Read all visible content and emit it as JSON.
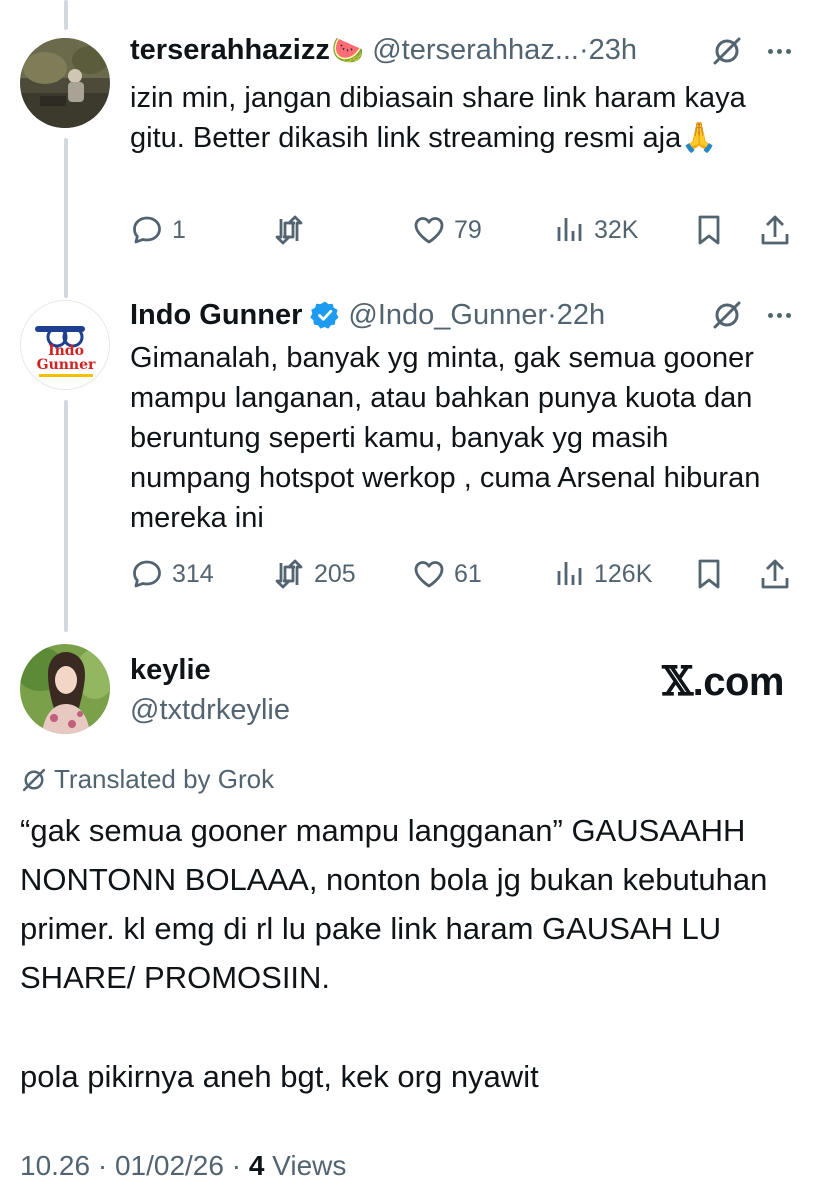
{
  "tweets": [
    {
      "name": "terserahhazizz",
      "emoji": "🍉",
      "handle": "@terserahhaz...",
      "time": "·23h",
      "text": "izin min, jangan dibiasain share link haram kaya gitu. Better dikasih link streaming resmi aja🙏",
      "replies": "1",
      "retweets": "",
      "likes": "79",
      "views": "32K"
    },
    {
      "name": "Indo Gunner",
      "handle": "@Indo_Gunner",
      "time": "·22h",
      "text": "Gimanalah, banyak yg minta, gak semua gooner mampu langanan, atau bahkan punya kuota dan beruntung seperti kamu, banyak yg masih numpang hotspot werkop , cuma Arsenal hiburan mereka ini",
      "replies": "314",
      "retweets": "205",
      "likes": "61",
      "views": "126K",
      "avatar_text": "Indo Gunner"
    }
  ],
  "main": {
    "name": "keylie",
    "handle": "@txtdrkeylie",
    "watermark_x": "𝕏",
    "watermark_rest": ".com",
    "translated_label": "Translated by Grok",
    "paragraph1": "“gak semua gooner mampu langganan” GAUSAAHH NONTONN BOLAAA, nonton bola jg bukan kebutuhan primer. kl emg di rl lu pake link haram GAUSAH LU SHARE/ PROMOSIIN.",
    "paragraph2": "pola pikirnya aneh bgt, kek org nyawit",
    "timestamp": "10.26 · 01/02/26 · ",
    "views_count": "4",
    "views_label": " Views"
  },
  "colors": {
    "text": "#0f1419",
    "secondary": "#536471",
    "verified": "#1d9bf0",
    "thread_line": "#cfd9de"
  }
}
